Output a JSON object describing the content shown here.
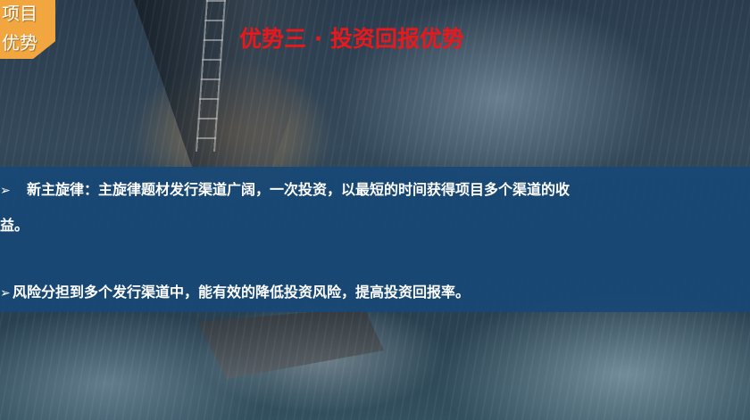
{
  "badge": {
    "line1": "项目",
    "line2": "优势"
  },
  "slide": {
    "title": "优势三 · 投资回报优势",
    "bullet_marker": "➢",
    "bullets": [
      {
        "line1": "新主旋律：主旋律题材发行渠道广阔，一次投资，以最短的时间获得项目多个渠道的收",
        "line2": "益。"
      },
      {
        "line1": "风险分担到多个发行渠道中，能有效的降低投资风险，提高投资回报率。"
      }
    ]
  },
  "colors": {
    "title": "#e8181c",
    "panel": "#184876",
    "badge": "#f2a63f",
    "text": "#ffffff"
  }
}
